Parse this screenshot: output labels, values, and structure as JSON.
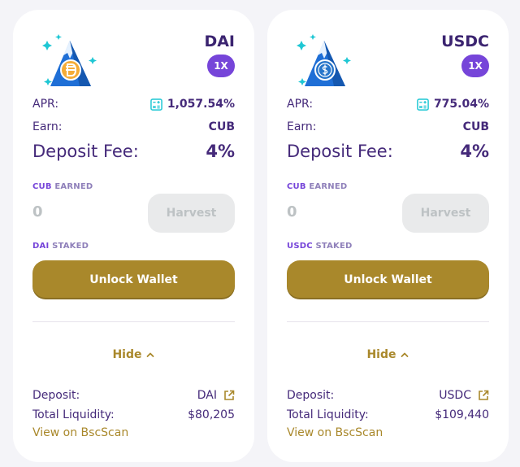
{
  "colors": {
    "primary_text": "#452a7a",
    "accent_purple": "#7645d9",
    "gold": "#a9882b",
    "disabled_bg": "#e9eaeb",
    "disabled_text": "#bdc2c4",
    "teal_icon": "#1fc7d4"
  },
  "farms": [
    {
      "pair": "DAI",
      "multiplier": "1X",
      "logo_coin_icon": "dai-coin-icon",
      "apr_label": "APR:",
      "apr": "1,057.54%",
      "earn_label": "Earn:",
      "earn": "CUB",
      "fee_label": "Deposit Fee:",
      "fee": "4%",
      "earned_token": "CUB",
      "earned_suffix": "EARNED",
      "earned_value": "0",
      "harvest_label": "Harvest",
      "staked_token": "DAI",
      "staked_suffix": "STAKED",
      "unlock_label": "Unlock Wallet",
      "toggle_label": "Hide",
      "deposit_label": "Deposit:",
      "deposit_token": "DAI",
      "liquidity_label": "Total Liquidity:",
      "liquidity": "$80,205",
      "bscscan_label": "View on BscScan"
    },
    {
      "pair": "USDC",
      "multiplier": "1X",
      "logo_coin_icon": "usdc-coin-icon",
      "apr_label": "APR:",
      "apr": "775.04%",
      "earn_label": "Earn:",
      "earn": "CUB",
      "fee_label": "Deposit Fee:",
      "fee": "4%",
      "earned_token": "CUB",
      "earned_suffix": "EARNED",
      "earned_value": "0",
      "harvest_label": "Harvest",
      "staked_token": "USDC",
      "staked_suffix": "STAKED",
      "unlock_label": "Unlock Wallet",
      "toggle_label": "Hide",
      "deposit_label": "Deposit:",
      "deposit_token": "USDC",
      "liquidity_label": "Total Liquidity:",
      "liquidity": "$109,440",
      "bscscan_label": "View on BscScan"
    }
  ]
}
